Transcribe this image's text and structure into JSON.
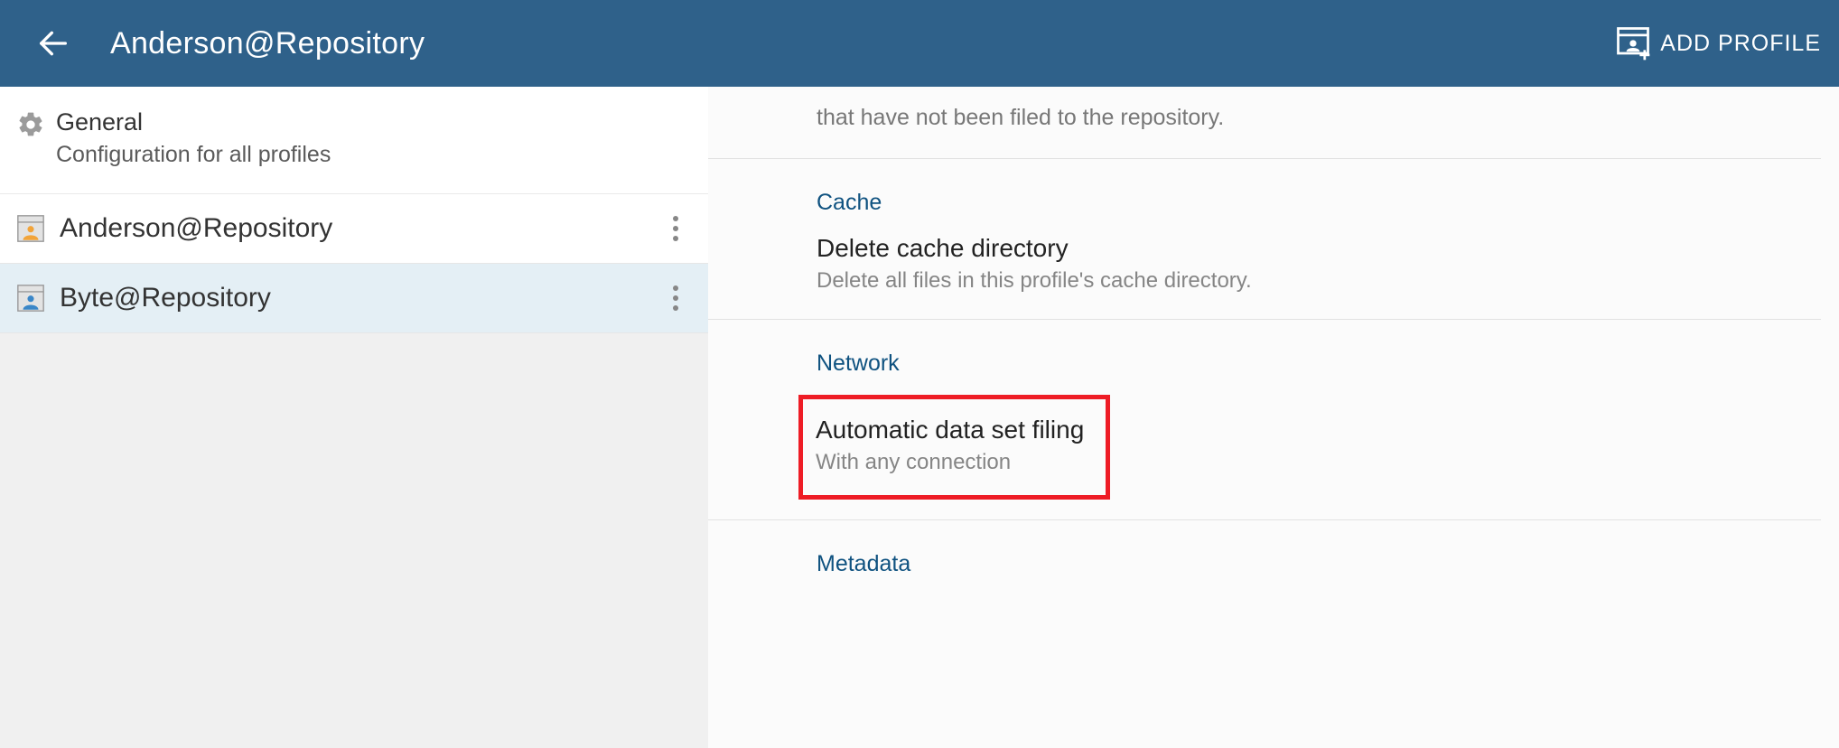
{
  "header": {
    "title": "Anderson@Repository",
    "add_profile_label": "ADD PROFILE"
  },
  "sidebar": {
    "general": {
      "title": "General",
      "subtitle": "Configuration for all profiles"
    },
    "profiles": [
      {
        "label": "Anderson@Repository",
        "active": false
      },
      {
        "label": "Byte@Repository",
        "active": true
      }
    ]
  },
  "detail": {
    "trailing_text": "that have not been filed to the repository.",
    "sections": {
      "cache": {
        "heading": "Cache",
        "item_title": "Delete cache directory",
        "item_sub": "Delete all files in this profile's cache directory."
      },
      "network": {
        "heading": "Network",
        "item_title": "Automatic data set filing",
        "item_sub": "With any connection"
      },
      "metadata": {
        "heading": "Metadata"
      }
    }
  }
}
